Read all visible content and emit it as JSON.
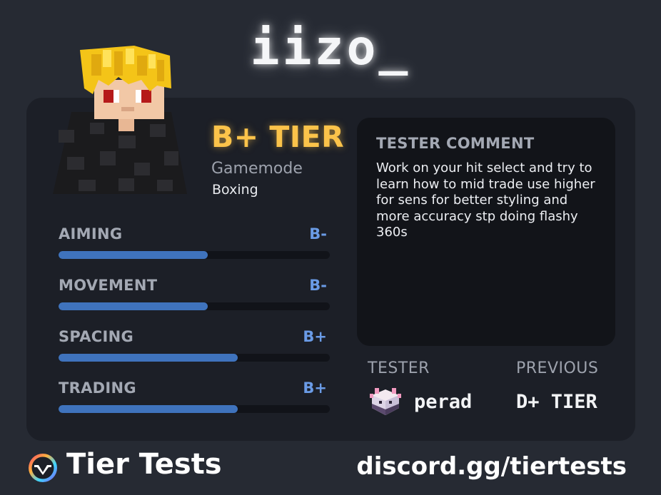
{
  "player": {
    "name": "iizo_"
  },
  "result": {
    "tier": "B+ TIER",
    "gamemode_label": "Gamemode",
    "gamemode": "Boxing"
  },
  "stats": [
    {
      "name": "AIMING",
      "grade": "B-",
      "level_percent": 55
    },
    {
      "name": "MOVEMENT",
      "grade": "B-",
      "level_percent": 55
    },
    {
      "name": "SPACING",
      "grade": "B+",
      "level_percent": 66
    },
    {
      "name": "TRADING",
      "grade": "B+",
      "level_percent": 66
    }
  ],
  "comment": {
    "title": "TESTER COMMENT",
    "text": "Work on your hit select and try to learn how to mid trade use higher for sens for better styling and more accuracy stp doing flashy 360s"
  },
  "tester": {
    "label": "TESTER",
    "name": "perad",
    "avatar_icon": "axolotl-cake-head-icon"
  },
  "previous": {
    "label": "PREVIOUS",
    "value": "D+ TIER"
  },
  "footer": {
    "brand": "Tier Tests",
    "link": "discord.gg/tiertests",
    "logo_icon": "tier-tests-logo-icon"
  },
  "colors": {
    "tier": "#fbc34a",
    "grade": "#6a9be6",
    "bar_fill": "#3f73bd",
    "card": "#1c1f27",
    "background": "#262a33"
  }
}
